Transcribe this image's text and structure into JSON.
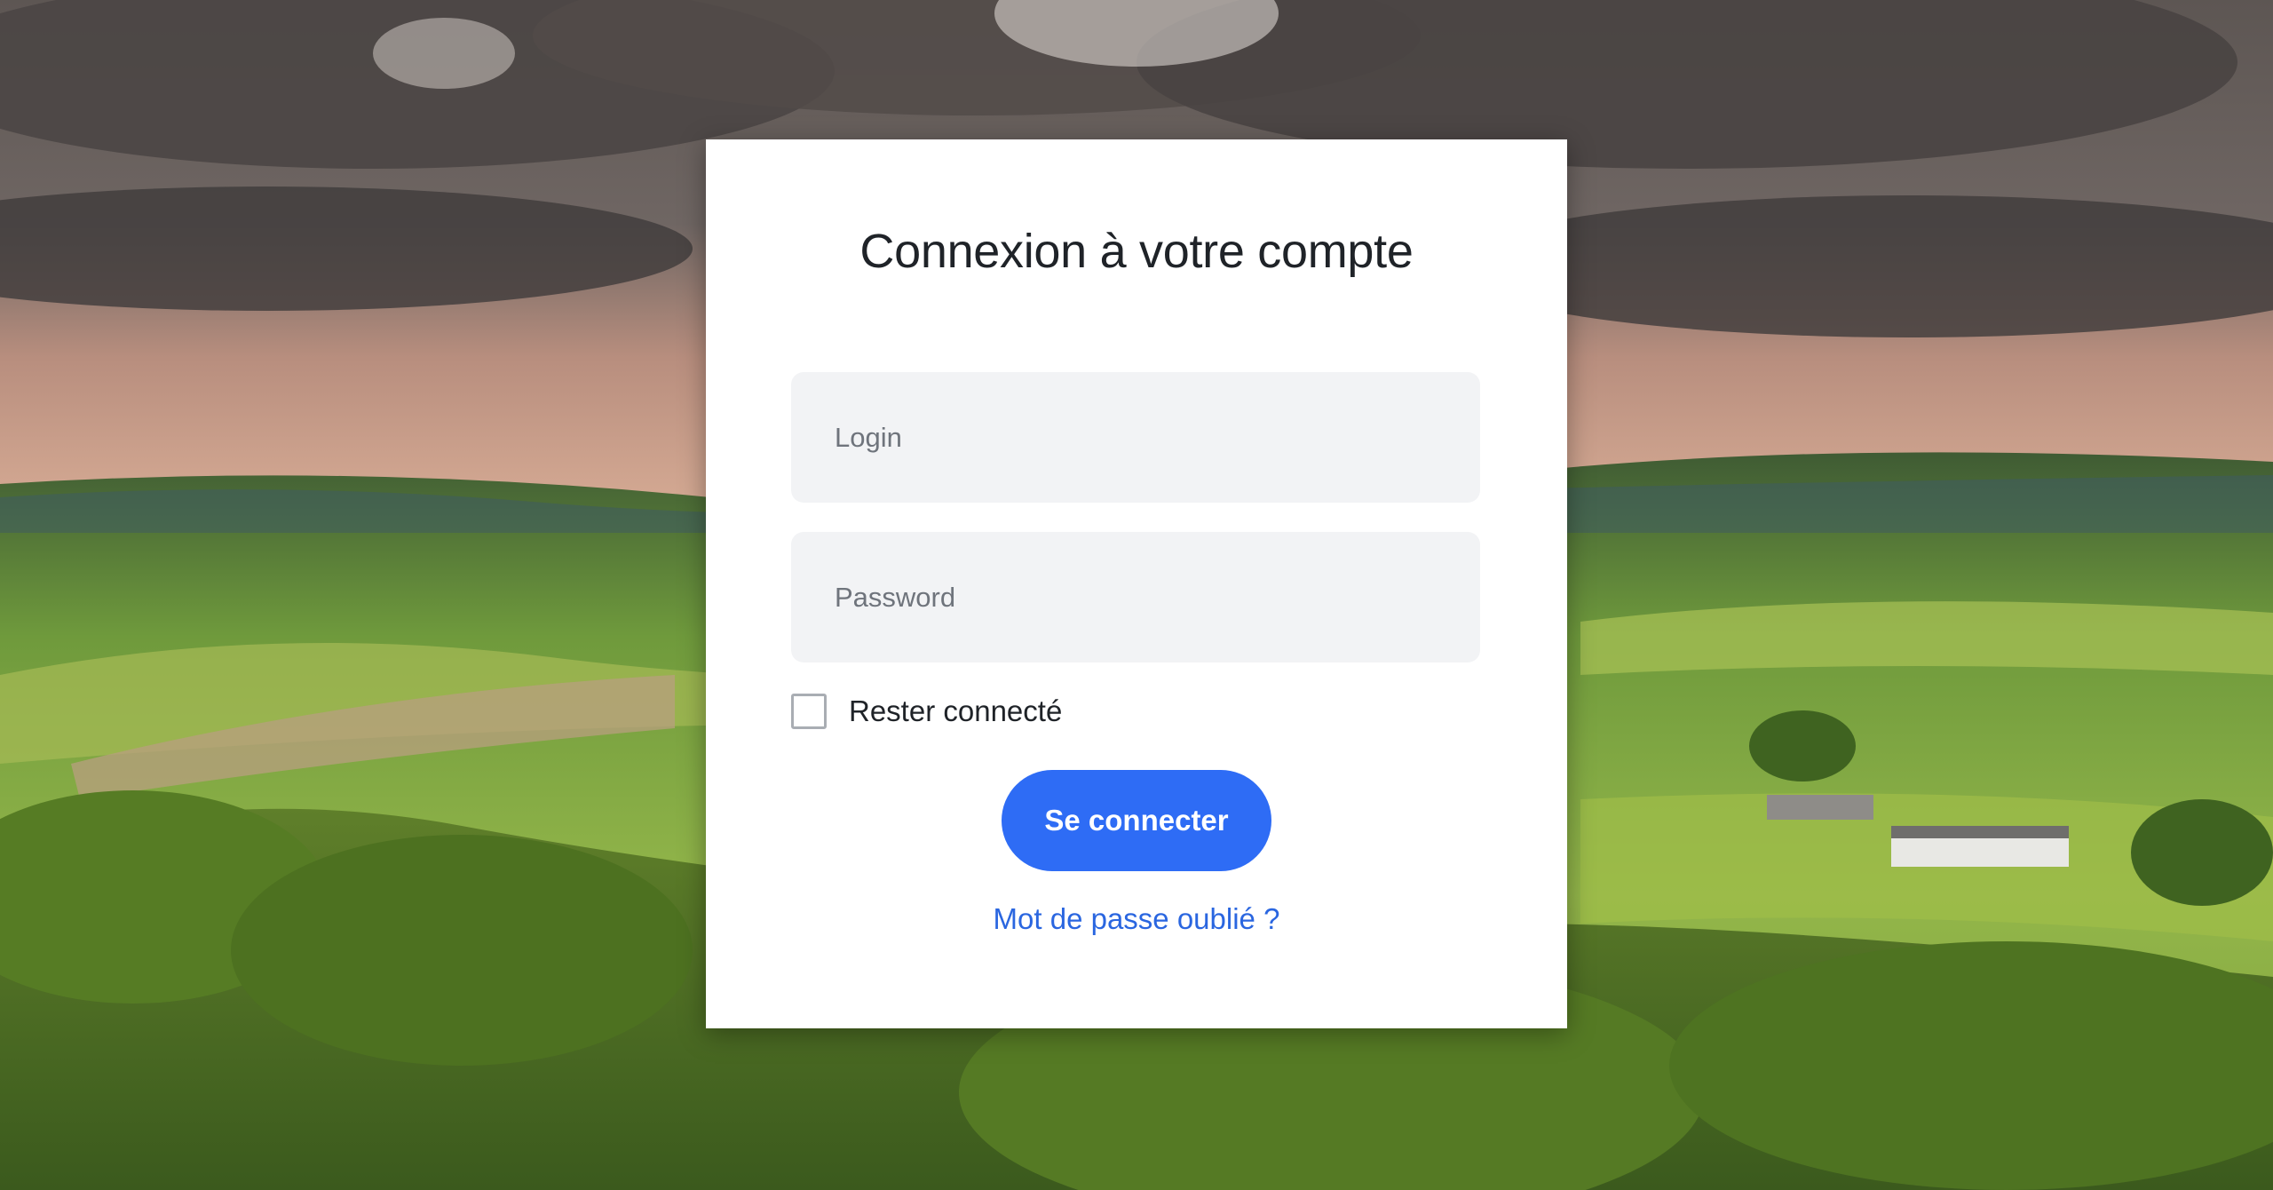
{
  "login_form": {
    "title": "Connexion à votre compte",
    "login_placeholder": "Login",
    "password_placeholder": "Password",
    "remember_label": "Rester connecté",
    "remember_checked": false,
    "submit_label": "Se connecter",
    "forgot_link": "Mot de passe oublié ?"
  },
  "colors": {
    "accent": "#2e6cf5",
    "link": "#2a66e0",
    "input_bg": "#f2f3f5",
    "card_bg": "#ffffff"
  }
}
